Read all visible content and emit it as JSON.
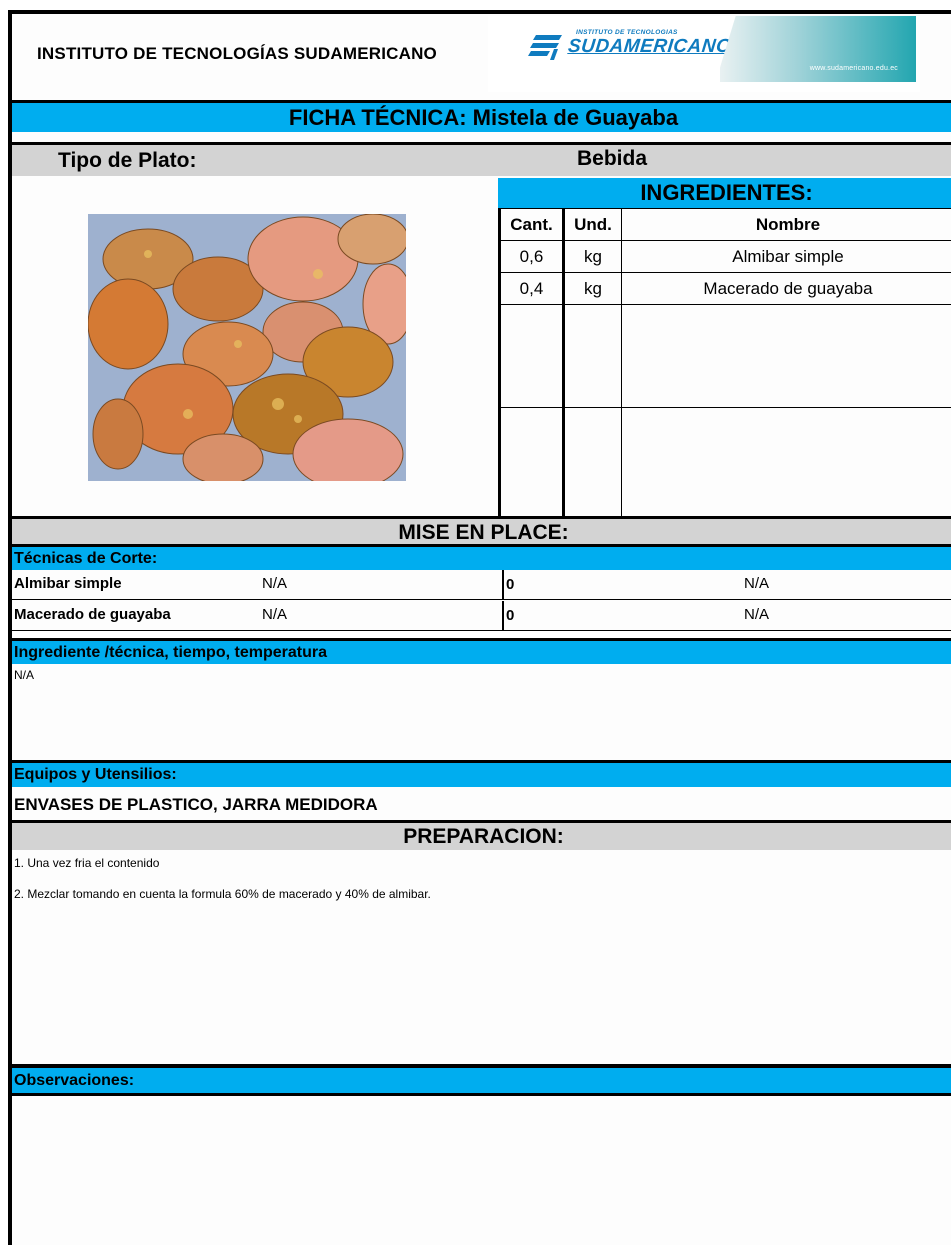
{
  "header": {
    "institute": "INSTITUTO DE TECNOLOGÍAS SUDAMERICANO",
    "logo_tagline": "INSTITUTO DE TECNOLOGIAS",
    "logo_word": "SUDAMERICANO",
    "logo_url": "www.sudamericano.edu.ec"
  },
  "title": "FICHA TÉCNICA: Mistela de Guayaba",
  "dish": {
    "label": "Tipo de Plato:",
    "value": "Bebida"
  },
  "ingredients": {
    "title": "INGREDIENTES:",
    "columns": [
      "Cant.",
      "Und.",
      "Nombre"
    ],
    "rows": [
      {
        "qty": "0,6",
        "unit": "kg",
        "name": "Almibar simple"
      },
      {
        "qty": "0,4",
        "unit": "kg",
        "name": "Macerado de guayaba"
      }
    ]
  },
  "mise_en_place": {
    "title": "MISE EN PLACE:",
    "cut_label": "Técnicas de Corte:",
    "cuts": [
      {
        "name": "Almibar simple",
        "c2": "N/A",
        "c3": "0",
        "c4": "N/A"
      },
      {
        "name": "Macerado de guayaba",
        "c2": "N/A",
        "c3": "0",
        "c4": "N/A"
      }
    ]
  },
  "technique": {
    "label": "Ingrediente /técnica, tiempo, temperatura",
    "text": "N/A"
  },
  "equipment": {
    "label": "Equipos y Utensilios:",
    "text": "ENVASES DE PLASTICO, JARRA MEDIDORA"
  },
  "preparation": {
    "title": "PREPARACION:",
    "steps": [
      "1. Una vez fria el contenido",
      "2. Mezclar tomando en cuenta la formula 60% de macerado y 40% de almibar."
    ]
  },
  "observations": {
    "label": "Observaciones:"
  }
}
